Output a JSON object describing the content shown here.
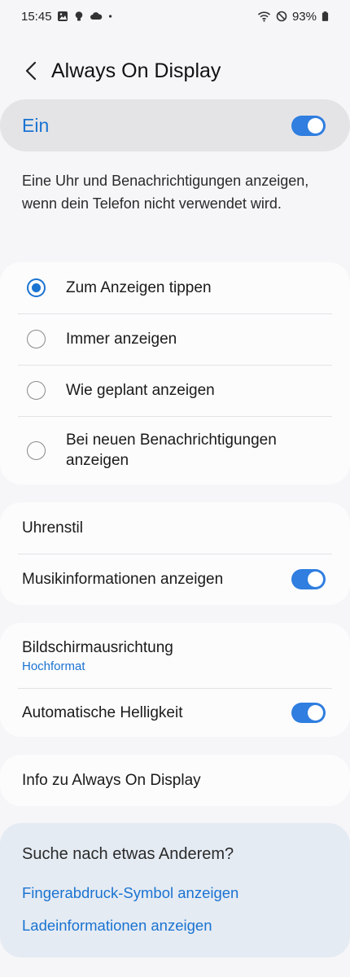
{
  "status_bar": {
    "time": "15:45",
    "battery": "93%",
    "left_icons": [
      "image-icon",
      "bulb-icon",
      "cloud-icon",
      "dot-icon"
    ],
    "right_icons": [
      "wifi-icon",
      "do-not-disturb-icon",
      "battery-icon"
    ]
  },
  "header": {
    "title": "Always On Display"
  },
  "master": {
    "label": "Ein",
    "enabled": true
  },
  "description": "Eine Uhr und Benachrichtigungen anzeigen, wenn dein Telefon nicht verwendet wird.",
  "display_mode": {
    "options": [
      {
        "label": "Zum Anzeigen tippen",
        "selected": true
      },
      {
        "label": "Immer anzeigen",
        "selected": false
      },
      {
        "label": "Wie geplant anzeigen",
        "selected": false
      },
      {
        "label": "Bei neuen Benachrichtigungen anzeigen",
        "selected": false
      }
    ]
  },
  "group1": {
    "clock_style": "Uhrenstil",
    "music_info": {
      "label": "Musikinformationen anzeigen",
      "enabled": true
    }
  },
  "group2": {
    "orientation": {
      "label": "Bildschirmausrichtung",
      "value": "Hochformat"
    },
    "auto_brightness": {
      "label": "Automatische Helligkeit",
      "enabled": true
    }
  },
  "about": {
    "label": "Info zu Always On Display"
  },
  "suggestions": {
    "title": "Suche nach etwas Anderem?",
    "links": [
      "Fingerabdruck-Symbol anzeigen",
      "Ladeinformationen anzeigen"
    ]
  },
  "colors": {
    "accent": "#1a73d1",
    "toggle_on": "#2f7ee0",
    "background": "#f6f6f8"
  }
}
